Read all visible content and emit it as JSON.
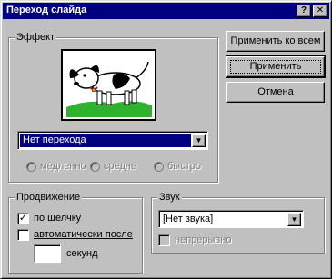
{
  "window": {
    "title": "Переход слайда"
  },
  "titlebar_buttons": {
    "help": "?",
    "close": "✕"
  },
  "effect": {
    "group_label": "Эффект",
    "selected": "Нет перехода",
    "speeds": [
      "медленно",
      "средне",
      "быстро"
    ]
  },
  "buttons": {
    "apply_all": "Применить ко всем",
    "apply": "Применить",
    "cancel": "Отмена"
  },
  "advance": {
    "group_label": "Продвижение",
    "on_click_label": "по щелчку",
    "on_click_checked": true,
    "auto_label": "автоматически после",
    "auto_checked": false,
    "seconds_value": "",
    "seconds_label": "секунд"
  },
  "sound": {
    "group_label": "Звук",
    "selected": "[Нет звука]",
    "loop_label": "непрерывно",
    "loop_checked": false
  },
  "icons": {
    "dropdown": "▼",
    "checkmark": "✓"
  }
}
